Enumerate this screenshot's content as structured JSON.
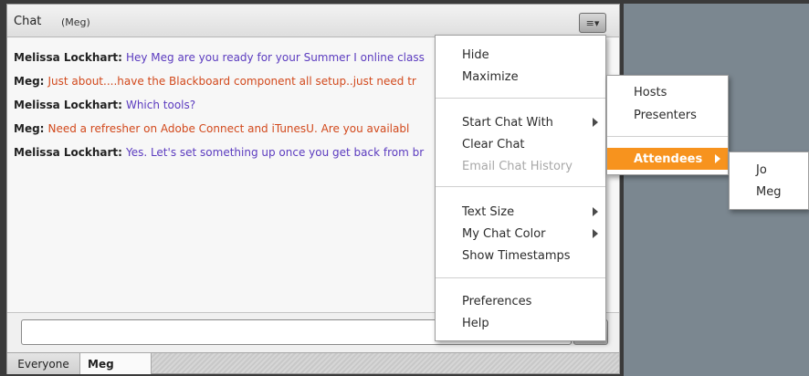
{
  "pod": {
    "title": "Chat",
    "subtitle": "(Meg)",
    "options_glyph": "≡▾"
  },
  "messages": [
    {
      "sender": "Melissa  Lockhart:",
      "text": "Hey Meg are you ready for your Summer I online class",
      "color": "#5b3bbf"
    },
    {
      "sender": "Meg:",
      "text": "Just about....have the Blackboard component all setup..just need tr",
      "color": "#d2491c"
    },
    {
      "sender": "Melissa  Lockhart:",
      "text": "Which tools?",
      "color": "#5b3bbf"
    },
    {
      "sender": "Meg:",
      "text": "Need a refresher on Adobe Connect and iTunesU.  Are you availabl",
      "color": "#d2491c"
    },
    {
      "sender": "Melissa  Lockhart:",
      "text": "Yes. Let's set something up once you get back from br",
      "color": "#5b3bbf"
    }
  ],
  "input": {
    "value": "",
    "placeholder": ""
  },
  "tabs": [
    {
      "label": "Everyone"
    },
    {
      "label": "Meg"
    }
  ],
  "menu": {
    "items": {
      "hide": "Hide",
      "maximize": "Maximize",
      "start_chat_with": "Start Chat With",
      "clear_chat": "Clear Chat",
      "email_chat_history": "Email Chat History",
      "text_size": "Text Size",
      "my_chat_color": "My Chat Color",
      "show_timestamps": "Show Timestamps",
      "preferences": "Preferences",
      "help": "Help"
    }
  },
  "submenu": {
    "hosts": "Hosts",
    "presenters": "Presenters",
    "attendees": "Attendees"
  },
  "attendees_submenu": {
    "items": [
      "Jo",
      "Meg"
    ]
  },
  "colors": {
    "highlight": "#f7931e",
    "sender_purple": "#5b3bbf",
    "sender_orange": "#d2491c"
  }
}
